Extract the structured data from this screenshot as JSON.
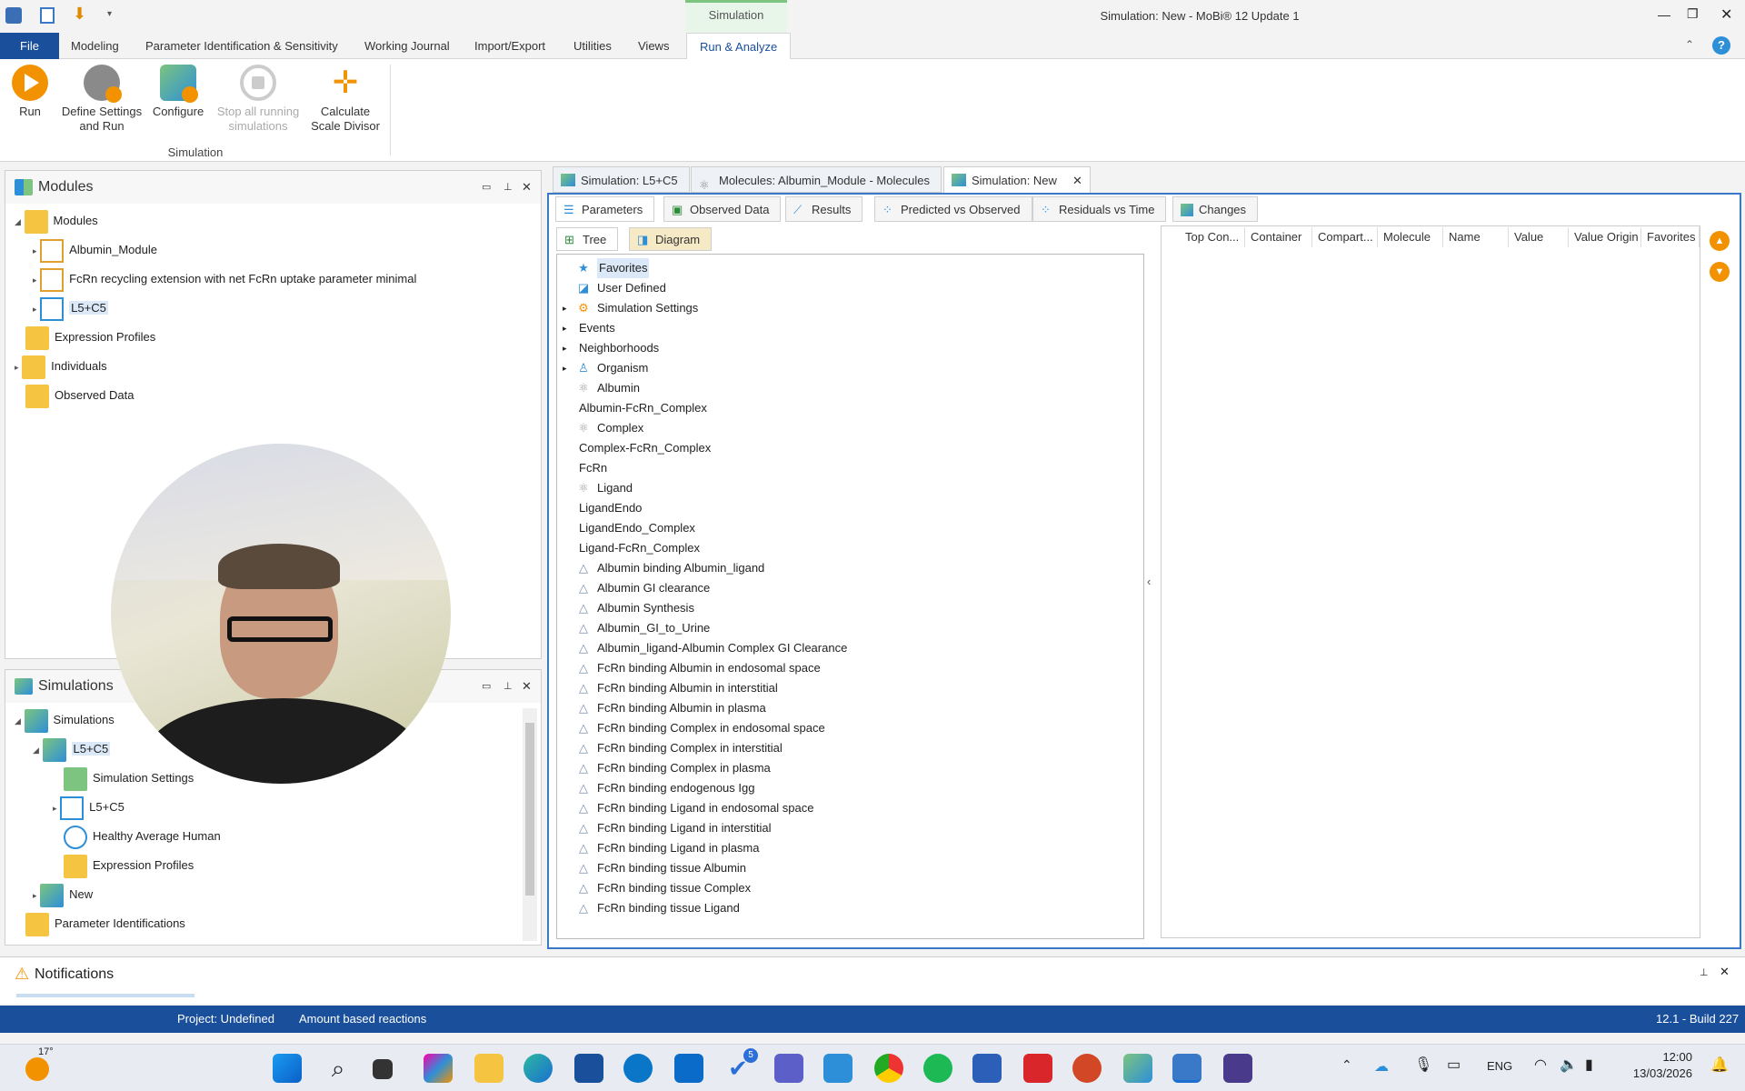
{
  "window": {
    "title": "Simulation: New - MoBi® 12 Update 1",
    "context_tab": "Simulation"
  },
  "ribbon_tabs": [
    "File",
    "Modeling",
    "Parameter Identification & Sensitivity",
    "Working Journal",
    "Import/Export",
    "Utilities",
    "Views",
    "Run & Analyze"
  ],
  "ribbon": {
    "run": "Run",
    "define_l1": "Define Settings",
    "define_l2": "and Run",
    "configure": "Configure",
    "stop_l1": "Stop all running",
    "stop_l2": "simulations",
    "calc_l1": "Calculate",
    "calc_l2": "Scale Divisor",
    "group": "Simulation"
  },
  "modules_panel": {
    "title": "Modules",
    "items": [
      {
        "label": "Modules"
      },
      {
        "label": "Albumin_Module"
      },
      {
        "label": "FcRn recycling extension with net FcRn uptake parameter minimal"
      },
      {
        "label": "L5+C5"
      },
      {
        "label": "Expression Profiles"
      },
      {
        "label": "Individuals"
      },
      {
        "label": "Observed Data"
      }
    ]
  },
  "simulations_panel": {
    "title": "Simulations",
    "items": [
      {
        "label": "Simulations"
      },
      {
        "label": "L5+C5"
      },
      {
        "label": "Simulation Settings"
      },
      {
        "label": "L5+C5"
      },
      {
        "label": "Healthy Average Human"
      },
      {
        "label": "Expression Profiles"
      },
      {
        "label": "New"
      },
      {
        "label": "Parameter Identifications"
      }
    ]
  },
  "doc_tabs": [
    {
      "label": "Simulation: L5+C5"
    },
    {
      "label": "Molecules: Albumin_Module - Molecules"
    },
    {
      "label": "Simulation: New"
    }
  ],
  "sub_tabs": [
    "Parameters",
    "Observed Data",
    "Results",
    "Predicted vs Observed",
    "Residuals vs Time",
    "Changes"
  ],
  "view_tabs": [
    "Tree",
    "Diagram"
  ],
  "param_tree": [
    "Favorites",
    "User Defined",
    "Simulation Settings",
    "Events",
    "Neighborhoods",
    "Organism",
    "Albumin",
    "Albumin-FcRn_Complex",
    "Complex",
    "Complex-FcRn_Complex",
    "FcRn",
    "Ligand",
    "LigandEndo",
    "LigandEndo_Complex",
    "Ligand-FcRn_Complex",
    "Albumin binding Albumin_ligand",
    "Albumin GI clearance",
    "Albumin Synthesis",
    "Albumin_GI_to_Urine",
    "Albumin_ligand-Albumin Complex GI Clearance",
    "FcRn binding Albumin in endosomal space",
    "FcRn binding Albumin in interstitial",
    "FcRn binding Albumin in plasma",
    "FcRn binding Complex in endosomal space",
    "FcRn binding Complex in interstitial",
    "FcRn binding Complex in plasma",
    "FcRn binding endogenous Igg",
    "FcRn binding Ligand in endosomal space",
    "FcRn binding Ligand in interstitial",
    "FcRn binding Ligand in plasma",
    "FcRn binding tissue Albumin",
    "FcRn binding tissue Complex",
    "FcRn binding tissue Ligand"
  ],
  "grid_columns": [
    "Top Con...",
    "Container",
    "Compart...",
    "Molecule",
    "Name",
    "Value",
    "Value Origin",
    "Favorites"
  ],
  "notifications": {
    "title": "Notifications"
  },
  "status": {
    "project": "Project: Undefined",
    "mode": "Amount based reactions",
    "build": "12.1 - Build 227"
  },
  "taskbar": {
    "weather": "17°",
    "lang": "ENG",
    "time": "12:00",
    "date": "13/03/2026",
    "badge": "5"
  }
}
